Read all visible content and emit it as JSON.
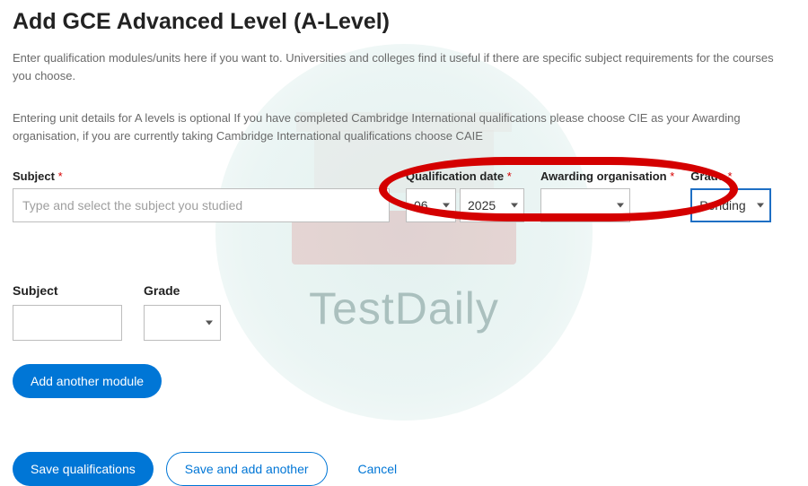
{
  "heading": "Add GCE Advanced Level (A-Level)",
  "intro1": "Enter qualification modules/units here if you want to. Universities and colleges find it useful if there are specific subject requirements for the courses you choose.",
  "intro2": "Entering unit details for A levels is optional If you have completed Cambridge International qualifications please choose CIE as your Awarding organisation, if you are currently taking Cambridge International qualifications choose CAIE",
  "asterisk": "*",
  "fields": {
    "subject": {
      "label": "Subject",
      "placeholder": "Type and select the subject you studied"
    },
    "qual_date": {
      "label": "Qualification date",
      "month": "06",
      "year": "2025"
    },
    "award_org": {
      "label": "Awarding organisation",
      "value": ""
    },
    "grade": {
      "label": "Grade",
      "value": "Pending"
    }
  },
  "unit": {
    "subject_label": "Subject",
    "grade_label": "Grade"
  },
  "buttons": {
    "add_module": "Add another module",
    "save": "Save qualifications",
    "save_add": "Save and add another",
    "cancel": "Cancel"
  },
  "watermark": "TestDaily"
}
